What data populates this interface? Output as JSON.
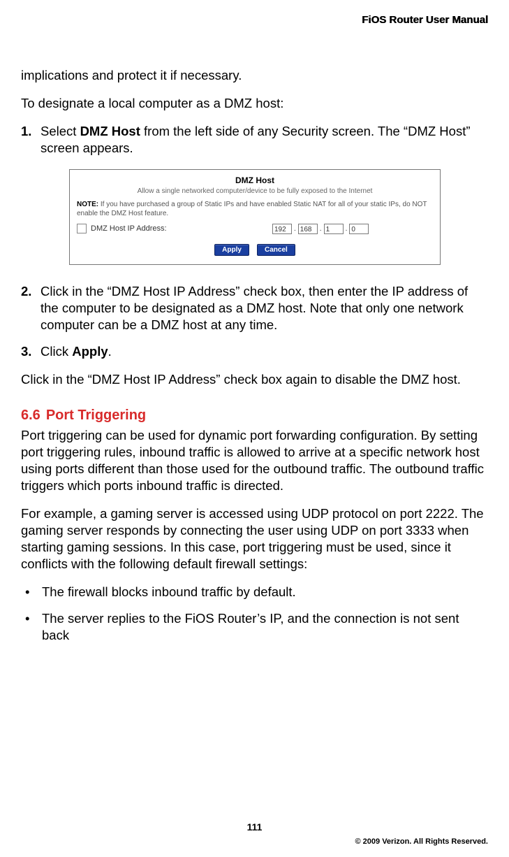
{
  "header": {
    "title": "FiOS Router User Manual"
  },
  "body": {
    "intro1": "implications and protect it if necessary.",
    "intro2": "To designate a local computer as a DMZ host:",
    "steps": [
      {
        "num": "1.",
        "pre": "Select ",
        "bold": "DMZ Host",
        "post": " from the left side of any Security screen. The “DMZ Host” screen appears."
      },
      {
        "num": "2.",
        "text": "Click in the “DMZ Host IP Address” check box, then enter the IP address of the computer to be designated as a DMZ host. Note that only one network computer can be a DMZ host at any time."
      },
      {
        "num": "3.",
        "pre": "Click ",
        "bold": "Apply",
        "post": "."
      }
    ],
    "after_steps": "Click in the “DMZ Host IP Address” check box again to disable the DMZ host.",
    "section": {
      "num": "6.6",
      "title": "Port Triggering"
    },
    "pt_para1": "Port triggering can be used for dynamic port forwarding configuration. By setting port triggering rules, inbound traffic is allowed to arrive at a specific network host using ports different than those used for the outbound traffic. The outbound traffic triggers which ports inbound traffic is directed.",
    "pt_para2": "For example, a gaming server is accessed using UDP protocol on port 2222. The gaming server responds by connecting the user using UDP on port 3333 when starting gaming sessions. In this case, port triggering must be used, since it conflicts with the following default firewall settings:",
    "bullets": [
      "The firewall blocks inbound traffic by default.",
      "The server replies to the FiOS Router’s IP, and the connection is not sent back"
    ]
  },
  "figure": {
    "title": "DMZ Host",
    "subtitle": "Allow a single networked computer/device to be fully exposed to the Internet",
    "note_label": "NOTE:",
    "note_text": " If you have purchased a group of Static IPs and have enabled Static NAT for all of your static IPs, do NOT enable the DMZ Host feature.",
    "row_label": "DMZ Host IP Address:",
    "ip": [
      "192",
      "168",
      "1",
      "0"
    ],
    "apply": "Apply",
    "cancel": "Cancel"
  },
  "footer": {
    "page": "111",
    "copyright": "© 2009 Verizon. All Rights Reserved."
  }
}
